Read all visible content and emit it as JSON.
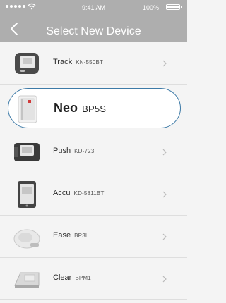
{
  "status_bar": {
    "time": "9:41 AM",
    "battery": "100%",
    "icons": [
      "signal-icon",
      "wifi-icon",
      "battery-icon"
    ]
  },
  "nav": {
    "title": "Select New Device",
    "back_icon": "chevron-left-icon"
  },
  "devices": [
    {
      "name": "Track",
      "model": "KN-550BT",
      "image": "wrist-monitor-device-icon",
      "selected": false
    },
    {
      "name": "Neo",
      "model": "BP5S",
      "image": "arm-cuff-device-icon",
      "selected": true
    },
    {
      "name": "Push",
      "model": "KD-723",
      "image": "wrist-monitor-device-icon",
      "selected": false
    },
    {
      "name": "Accu",
      "model": "KD-5811BT",
      "image": "tablet-monitor-device-icon",
      "selected": false
    },
    {
      "name": "Ease",
      "model": "BP3L",
      "image": "rounded-monitor-device-icon",
      "selected": false
    },
    {
      "name": "Clear",
      "model": "BPM1",
      "image": "desktop-monitor-device-icon",
      "selected": false
    }
  ],
  "colors": {
    "header": "#aeaeae",
    "background": "#f4f4f4",
    "selection_border": "#3d7aa7",
    "chevron": "#b9b9b9"
  }
}
